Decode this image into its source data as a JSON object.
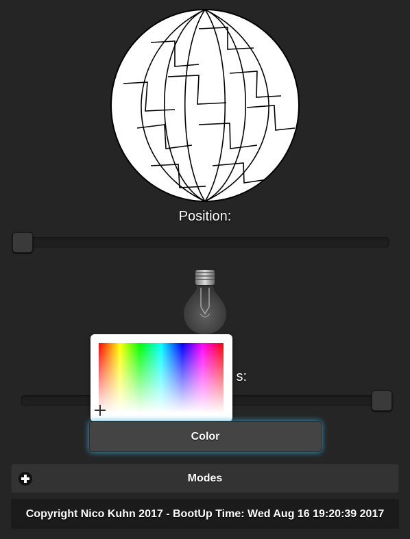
{
  "controls": {
    "position_label": "Position:",
    "position_value": 0,
    "brightness_label_partial": "s:",
    "brightness_value": 1.0
  },
  "buttons": {
    "color_label": "Color",
    "modes_label": "Modes"
  },
  "footer": {
    "text": "Copyright Nico Kuhn 2017 - BootUp Time: Wed Aug 16 19:20:39 2017"
  },
  "colors": {
    "background": "#252525",
    "accent_glow": "#36a8cf"
  },
  "icons": {
    "sphere": "lamp-sphere-icon",
    "bulb": "light-bulb-icon",
    "modes_toggle": "plus-icon",
    "picker_cursor": "crosshair-icon"
  }
}
